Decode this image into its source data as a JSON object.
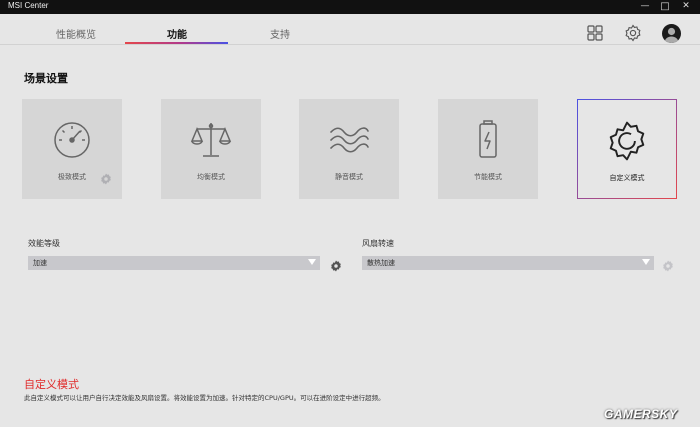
{
  "window": {
    "title": "MSI Center",
    "controls": {
      "minimize": "—",
      "maximize": "□",
      "close": "✕"
    }
  },
  "nav": {
    "tabs": [
      {
        "label": "性能概览",
        "active": false
      },
      {
        "label": "功能",
        "active": true
      },
      {
        "label": "支持",
        "active": false
      }
    ],
    "icons": [
      "grid-icon",
      "gear-icon",
      "avatar"
    ]
  },
  "section": {
    "title": "场景设置"
  },
  "modes": [
    {
      "label": "极致模式",
      "icon": "speedometer-icon",
      "has_settings": true
    },
    {
      "label": "均衡模式",
      "icon": "balance-scale-icon",
      "has_settings": false
    },
    {
      "label": "静音模式",
      "icon": "waves-icon",
      "has_settings": false
    },
    {
      "label": "节能模式",
      "icon": "battery-icon",
      "has_settings": false
    },
    {
      "label": "自定义模式",
      "icon": "gear-icon",
      "selected": true
    }
  ],
  "performance": {
    "label": "效能等级",
    "value": "加速"
  },
  "fan": {
    "label": "风扇转速",
    "value": "散热加速"
  },
  "footer": {
    "title": "自定义模式",
    "description": "此自定义模式可以让用户自行决定效能及风扇设置。将效能设置为加速。针对特定的CPU/GPU。可以在进阶设定中进行超频。"
  },
  "watermark": "GAMERSKY",
  "colors": {
    "accent_red": "#e4474b",
    "accent_blue": "#4a52e4",
    "title_red": "#e02a2a"
  }
}
